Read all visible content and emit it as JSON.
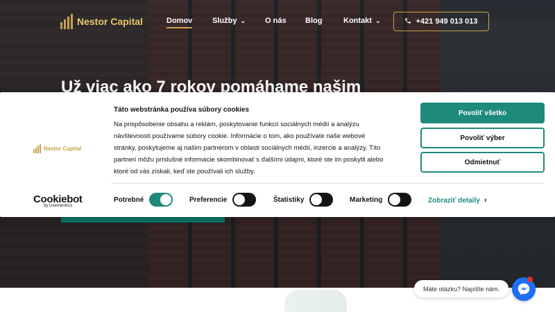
{
  "header": {
    "logo_text": "Nestor Capital",
    "nav": [
      {
        "label": "Domov"
      },
      {
        "label": "Služby"
      },
      {
        "label": "O nás"
      },
      {
        "label": "Blog"
      },
      {
        "label": "Kontakt"
      }
    ],
    "phone": "+421 949 013 013",
    "phone_icon": "phone-icon"
  },
  "hero": {
    "title": "Už viac ako 7 rokov pomáhame našim"
  },
  "cookie_banner": {
    "logo_text": "Nestor Capital",
    "title": "Táto webstránka používa súbory cookies",
    "body_lines": [
      "Na prispôsobenie obsahu a reklám, poskytovanie funkcií sociálnych médií a analýzu",
      "návštevnosti používame súbory cookie. Informácie o tom, ako používate naše webové",
      "stránky, poskytujeme aj našim partnerom v oblasti sociálnych médií, inzercie a analýzy. Títo",
      "partneri môžu príslušné informácie skombinovať s ďalšími údajmi, ktoré ste im poskytli alebo",
      "ktoré od vás získali, keď ste používali ich služby."
    ],
    "buttons": {
      "allow_all": "Povoliť všetko",
      "allow_selection": "Povoliť výber",
      "deny": "Odmietnuť"
    },
    "brand": {
      "name": "Cookiebot",
      "sub": "by Usercentrics"
    },
    "toggles": [
      {
        "label": "Potrebné",
        "on": true
      },
      {
        "label": "Preferencie",
        "on": false
      },
      {
        "label": "Štatistiky",
        "on": false
      },
      {
        "label": "Marketing",
        "on": false
      }
    ],
    "details_link": "Zobraziť detaily"
  },
  "chat": {
    "bubble_text": "Máte otázku? Napíšte nám.",
    "icon": "messenger-icon"
  },
  "colors": {
    "gold": "#c9a24a",
    "teal": "#1d8a7c",
    "messenger_blue": "#1c6ef2"
  }
}
